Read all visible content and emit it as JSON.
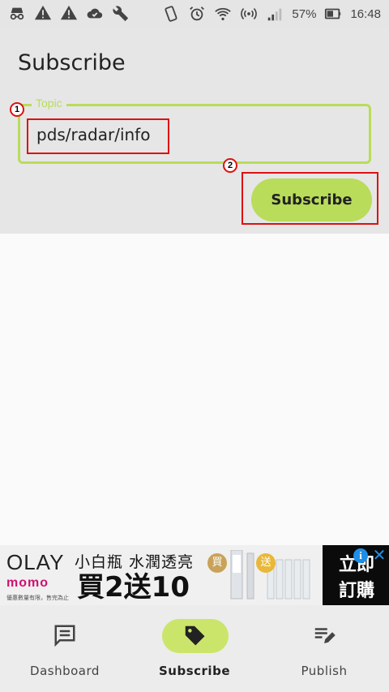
{
  "status_bar": {
    "left_icons": [
      "incognito-icon",
      "warning-icon",
      "warning-icon",
      "cloud-check-icon",
      "wrench-icon"
    ],
    "right_icons": [
      "vibrate-icon",
      "alarm-icon",
      "wifi-icon",
      "hotspot-icon",
      "signal-icon",
      "battery-icon"
    ],
    "battery": "57%",
    "time": "16:48"
  },
  "header": {
    "title": "Subscribe"
  },
  "form": {
    "topic_label": "Topic",
    "topic_value": "pds/radar/info",
    "subscribe_button": "Subscribe"
  },
  "annotations": {
    "badge_1": "1",
    "badge_2": "2"
  },
  "ad": {
    "brand": "OLAY",
    "sub_brand": "momo",
    "fine_print": "優惠數量有限，售完為止",
    "line1": "小白瓶 水潤透亮",
    "line2": "買2送10",
    "bubble_buy": "買",
    "bubble_gift": "送",
    "cta_1": "立即",
    "cta_2": "訂購"
  },
  "bottom_nav": {
    "items": [
      {
        "label": "Dashboard",
        "icon": "dashboard-icon"
      },
      {
        "label": "Subscribe",
        "icon": "tag-icon",
        "active": true
      },
      {
        "label": "Publish",
        "icon": "edit-list-icon"
      }
    ]
  },
  "colors": {
    "accent": "#b9dc5a",
    "accent_pill": "#cbe56a",
    "annotation": "#dd1111"
  }
}
